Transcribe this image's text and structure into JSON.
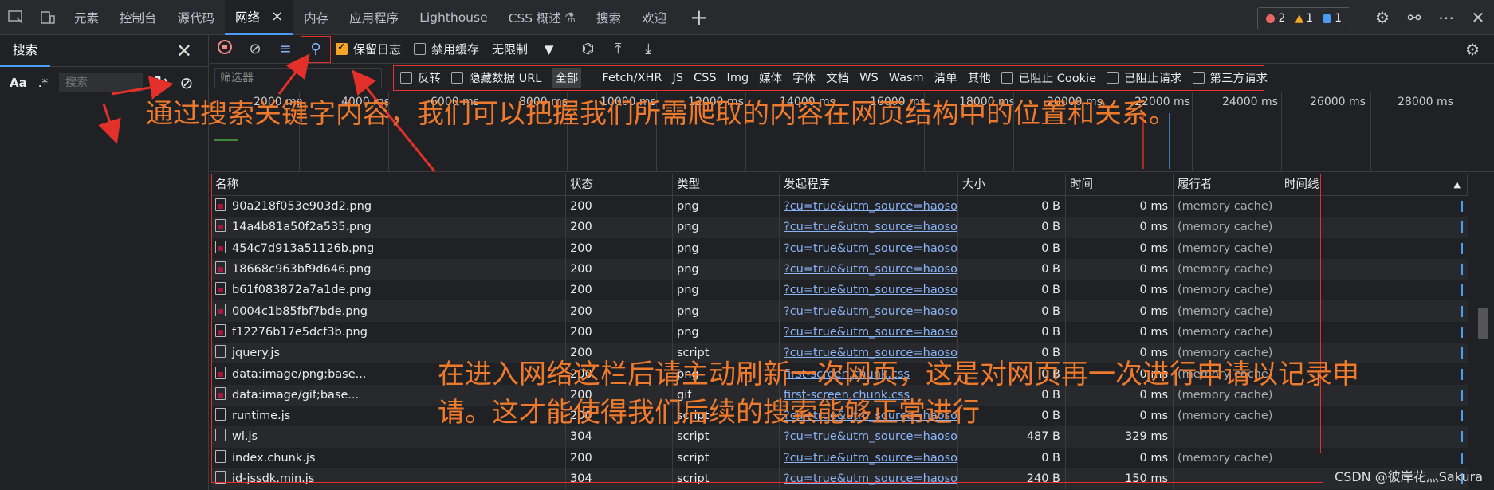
{
  "tabs": [
    "元素",
    "控制台",
    "源代码",
    "网络",
    "内存",
    "应用程序",
    "Lighthouse",
    "CSS 概述",
    "搜索",
    "欢迎"
  ],
  "active_tab_close": "×",
  "badges": {
    "errors": "2",
    "warnings": "1",
    "info": "1"
  },
  "colors": {
    "accent": "#4a9cf0",
    "annotation": "#f07a2c",
    "frame": "#e3302a"
  },
  "search_panel": {
    "title": "搜索",
    "placeholder": "搜索",
    "aa": "Aa",
    "regex": ".*"
  },
  "toolbar": {
    "preserve_log": "保留日志",
    "disable_cache": "禁用缓存",
    "throttle": "无限制"
  },
  "filter": {
    "placeholder": "筛选器",
    "invert": "反转",
    "hide_data_urls": "隐藏数据 URL",
    "types": [
      "全部",
      "Fetch/XHR",
      "JS",
      "CSS",
      "Img",
      "媒体",
      "字体",
      "文档",
      "WS",
      "Wasm",
      "清单",
      "其他"
    ],
    "blocked_cookies": "已阻止 Cookie",
    "blocked_requests": "已阻止请求",
    "third_party": "第三方请求"
  },
  "overview_ticks": [
    "2000 ms",
    "4000 ms",
    "6000 ms",
    "8000 ms",
    "10000 ms",
    "12000 ms",
    "14000 ms",
    "16000 ms",
    "18000 ms",
    "20000 ms",
    "22000 ms",
    "24000 ms",
    "26000 ms",
    "28000 ms"
  ],
  "columns": [
    "名称",
    "状态",
    "类型",
    "发起程序",
    "大小",
    "时间",
    "履行者",
    "时间线"
  ],
  "rows": [
    {
      "name": "90a218f053e903d2.png",
      "status": "200",
      "type": "png",
      "initiator": "?cu=true&utm_source=haoso...",
      "size": "0 B",
      "time": "0 ms",
      "fulfilled": "(memory cache)",
      "icon": "img"
    },
    {
      "name": "14a4b81a50f2a535.png",
      "status": "200",
      "type": "png",
      "initiator": "?cu=true&utm_source=haoso...",
      "size": "0 B",
      "time": "0 ms",
      "fulfilled": "(memory cache)",
      "icon": "img"
    },
    {
      "name": "454c7d913a51126b.png",
      "status": "200",
      "type": "png",
      "initiator": "?cu=true&utm_source=haoso...",
      "size": "0 B",
      "time": "0 ms",
      "fulfilled": "(memory cache)",
      "icon": "img"
    },
    {
      "name": "18668c963bf9d646.png",
      "status": "200",
      "type": "png",
      "initiator": "?cu=true&utm_source=haoso...",
      "size": "0 B",
      "time": "0 ms",
      "fulfilled": "(memory cache)",
      "icon": "img"
    },
    {
      "name": "b61f083872a7a1de.png",
      "status": "200",
      "type": "png",
      "initiator": "?cu=true&utm_source=haoso...",
      "size": "0 B",
      "time": "0 ms",
      "fulfilled": "(memory cache)",
      "icon": "img"
    },
    {
      "name": "0004c1b85fbf7bde.png",
      "status": "200",
      "type": "png",
      "initiator": "?cu=true&utm_source=haoso...",
      "size": "0 B",
      "time": "0 ms",
      "fulfilled": "(memory cache)",
      "icon": "img"
    },
    {
      "name": "f12276b17e5dcf3b.png",
      "status": "200",
      "type": "png",
      "initiator": "?cu=true&utm_source=haoso...",
      "size": "0 B",
      "time": "0 ms",
      "fulfilled": "(memory cache)",
      "icon": "img"
    },
    {
      "name": "jquery.js",
      "status": "200",
      "type": "script",
      "initiator": "?cu=true&utm_source=haoso...",
      "size": "0 B",
      "time": "0 ms",
      "fulfilled": "(memory cache)",
      "icon": "doc"
    },
    {
      "name": "data:image/png;base...",
      "status": "200",
      "type": "png",
      "initiator": "first-screen.chunk.css",
      "size": "0 B",
      "time": "0 ms",
      "fulfilled": "(memory cache)",
      "icon": "img"
    },
    {
      "name": "data:image/gif;base...",
      "status": "200",
      "type": "gif",
      "initiator": "first-screen.chunk.css",
      "size": "0 B",
      "time": "0 ms",
      "fulfilled": "(memory cache)",
      "icon": "img"
    },
    {
      "name": "runtime.js",
      "status": "200",
      "type": "script",
      "initiator": "?cu=true&utm_source=haoso...",
      "size": "0 B",
      "time": "0 ms",
      "fulfilled": "(memory cache)",
      "icon": "doc"
    },
    {
      "name": "wl.js",
      "status": "304",
      "type": "script",
      "initiator": "?cu=true&utm_source=haoso...",
      "size": "487 B",
      "time": "329 ms",
      "fulfilled": "",
      "icon": "doc"
    },
    {
      "name": "index.chunk.js",
      "status": "200",
      "type": "script",
      "initiator": "?cu=true&utm_source=haoso...",
      "size": "0 B",
      "time": "0 ms",
      "fulfilled": "(memory cache)",
      "icon": "doc"
    },
    {
      "name": "id-jssdk.min.js",
      "status": "304",
      "type": "script",
      "initiator": "?cu=true&utm_source=haoso...",
      "size": "240 B",
      "time": "150 ms",
      "fulfilled": "",
      "icon": "doc"
    }
  ],
  "annotations": {
    "top": "通过搜索关键字内容，我们可以把握我们所需爬取的内容在网页结构中的位置和关系。",
    "bottom1": "在进入网络这栏后请主动刷新一次网页，这是对网页再一次进行申请以记录申",
    "bottom2": "请。这才能使得我们后续的搜索能够正常进行"
  },
  "watermark": "CSDN @彼岸花灬Sakura"
}
